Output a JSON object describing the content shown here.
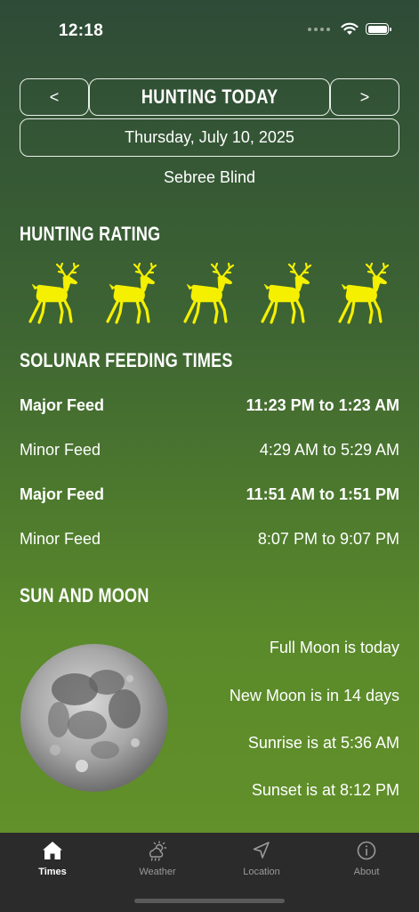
{
  "status_bar": {
    "time": "12:18"
  },
  "header": {
    "prev_label": "<",
    "title": "HUNTING TODAY",
    "next_label": ">",
    "date": "Thursday, July 10, 2025",
    "location": "Sebree Blind"
  },
  "rating": {
    "title": "HUNTING RATING",
    "value": 5,
    "max": 5,
    "icon": "deer-icon",
    "icon_color": "#f5f000"
  },
  "feeding": {
    "title": "SOLUNAR FEEDING TIMES",
    "rows": [
      {
        "label": "Major Feed",
        "time": "11:23 PM to 1:23 AM",
        "major": true
      },
      {
        "label": "Minor Feed",
        "time": "4:29 AM to 5:29 AM",
        "major": false
      },
      {
        "label": "Major Feed",
        "time": "11:51 AM to 1:51 PM",
        "major": true
      },
      {
        "label": "Minor Feed",
        "time": "8:07 PM to 9:07 PM",
        "major": false
      }
    ]
  },
  "sun_moon": {
    "title": "SUN AND MOON",
    "full_moon": "Full Moon is today",
    "new_moon": "New Moon is in 14 days",
    "sunrise": "Sunrise is at 5:36 AM",
    "sunset": "Sunset is at 8:12 PM",
    "moon_image": "full-moon-image"
  },
  "tabs": [
    {
      "label": "Times",
      "icon": "home-icon",
      "active": true
    },
    {
      "label": "Weather",
      "icon": "weather-icon",
      "active": false
    },
    {
      "label": "Location",
      "icon": "location-arrow-icon",
      "active": false
    },
    {
      "label": "About",
      "icon": "info-icon",
      "active": false
    }
  ],
  "colors": {
    "background_top": "#2e4b37",
    "background_bottom": "#65922a",
    "deer_yellow": "#f5f000",
    "tab_bar": "#2b2b2b"
  }
}
